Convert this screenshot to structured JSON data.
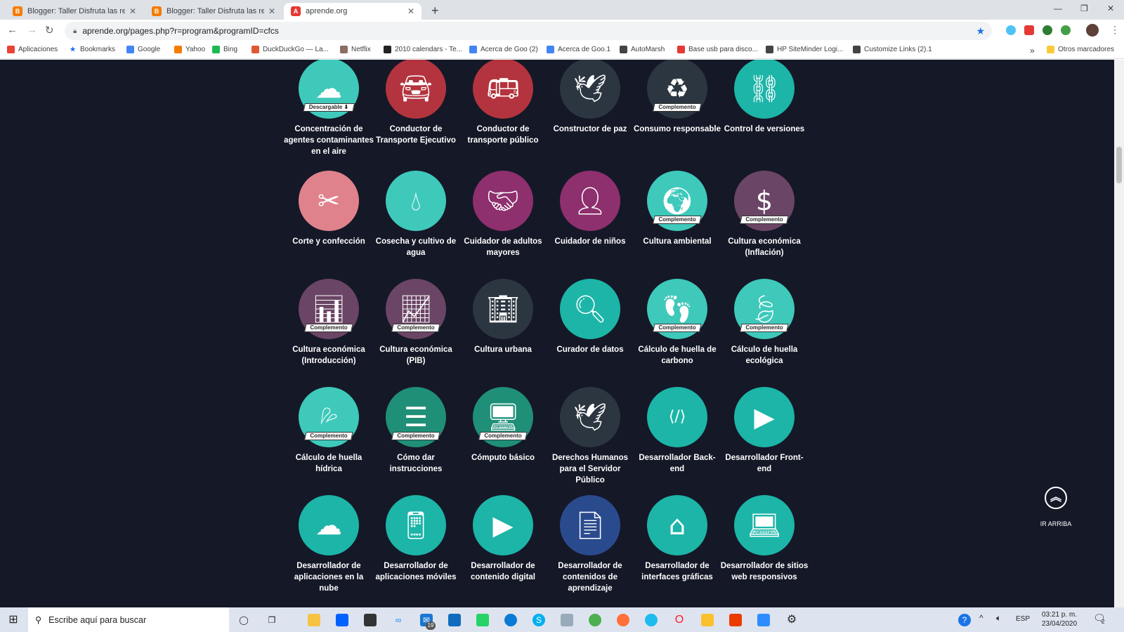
{
  "browser": {
    "tabs": [
      {
        "title": "Blogger: Taller Disfruta las redes",
        "icon": "blogger-icon",
        "color": "#f57c00"
      },
      {
        "title": "Blogger: Taller Disfruta las redes",
        "icon": "blogger-icon",
        "color": "#f57c00"
      },
      {
        "title": "aprende.org",
        "icon": "aprende-icon",
        "color": "#e53935"
      }
    ],
    "url": "aprende.org/pages.php?r=program&programID=cfcs",
    "bookmarks": [
      {
        "label": "Aplicaciones",
        "icon": "apps-grid-icon"
      },
      {
        "label": "Bookmarks",
        "icon": "star-icon"
      },
      {
        "label": "Google",
        "icon": "google-icon"
      },
      {
        "label": "Yahoo",
        "icon": "blogger-icon"
      },
      {
        "label": "Bing",
        "icon": "spotify-icon"
      },
      {
        "label": "DuckDuckGo — La...",
        "icon": "duckduckgo-icon"
      },
      {
        "label": "Netflix",
        "icon": "netflix-icon"
      },
      {
        "label": "2010 calendars - Te...",
        "icon": "wikipedia-icon"
      },
      {
        "label": "Acerca de Goo (2)",
        "icon": "google-icon"
      },
      {
        "label": "Acerca de Goo.1",
        "icon": "google-icon"
      },
      {
        "label": "AutoMarsh",
        "icon": "globe-icon"
      },
      {
        "label": "Base usb para disco...",
        "icon": "youtube-icon"
      },
      {
        "label": "HP SiteMinder Logi...",
        "icon": "globe-icon"
      },
      {
        "label": "Customize Links (2).1",
        "icon": "globe-icon"
      }
    ],
    "more_bookmarks": "»",
    "other_bookmarks": "Otros marcadores"
  },
  "programs": [
    {
      "label": "Concentración de agentes contaminantes en el aire",
      "color": "#3ec9bb",
      "icon": "cloud-building-icon",
      "badge": "Descargable ⬇"
    },
    {
      "label": "Conductor de Transporte Ejecutivo",
      "color": "#b3343e",
      "icon": "car-icon",
      "badge": ""
    },
    {
      "label": "Conductor de transporte público",
      "color": "#b3343e",
      "icon": "bus-icon",
      "badge": ""
    },
    {
      "label": "Constructor de paz",
      "color": "#2c3640",
      "icon": "dove-icon",
      "badge": ""
    },
    {
      "label": "Consumo responsable",
      "color": "#2c3640",
      "icon": "recycle-bag-icon",
      "badge": "Complemento"
    },
    {
      "label": "Control de versiones",
      "color": "#1cb5a8",
      "icon": "network-icon",
      "badge": ""
    },
    {
      "label": "Corte y confección",
      "color": "#e0828c",
      "icon": "thread-icon",
      "badge": ""
    },
    {
      "label": "Cosecha y cultivo de agua",
      "color": "#3ec9bb",
      "icon": "drops-icon",
      "badge": ""
    },
    {
      "label": "Cuidador de adultos mayores",
      "color": "#8e2f6e",
      "icon": "handshake-icon",
      "badge": ""
    },
    {
      "label": "Cuidador de niños",
      "color": "#8e2f6e",
      "icon": "caregiver-icon",
      "badge": ""
    },
    {
      "label": "Cultura ambiental",
      "color": "#3ec9bb",
      "icon": "globe-hands-icon",
      "badge": "Complemento"
    },
    {
      "label": "Cultura económica (Inflación)",
      "color": "#6b4565",
      "icon": "dollar-chart-icon",
      "badge": "Complemento"
    },
    {
      "label": "Cultura económica (Introducción)",
      "color": "#6b4565",
      "icon": "economy-icon",
      "badge": "Complemento"
    },
    {
      "label": "Cultura económica (PIB)",
      "color": "#6b4565",
      "icon": "pib-icon",
      "badge": "Complemento"
    },
    {
      "label": "Cultura urbana",
      "color": "#2c3640",
      "icon": "city-people-icon",
      "badge": ""
    },
    {
      "label": "Curador de datos",
      "color": "#1cb5a8",
      "icon": "monitor-search-icon",
      "badge": ""
    },
    {
      "label": "Cálculo de huella de carbono",
      "color": "#3ec9bb",
      "icon": "co2-footprint-icon",
      "badge": "Complemento"
    },
    {
      "label": "Cálculo de huella ecológica",
      "color": "#3ec9bb",
      "icon": "leaf-footprint-icon",
      "badge": "Complemento"
    },
    {
      "label": "Cálculo de huella hídrica",
      "color": "#3ec9bb",
      "icon": "water-footprint-icon",
      "badge": "Complemento"
    },
    {
      "label": "Cómo dar instrucciones",
      "color": "#1f8f78",
      "icon": "checklist-icon",
      "badge": "Complemento"
    },
    {
      "label": "Cómputo básico",
      "color": "#1f8f78",
      "icon": "computer-click-icon",
      "badge": "Complemento"
    },
    {
      "label": "Derechos Humanos para el Servidor Público",
      "color": "#2c3640",
      "icon": "dove-chain-icon",
      "badge": ""
    },
    {
      "label": "Desarrollador Back-end",
      "color": "#1cb5a8",
      "icon": "code-monitor-icon",
      "badge": ""
    },
    {
      "label": "Desarrollador Front-end",
      "color": "#1cb5a8",
      "icon": "web-monitor-icon",
      "badge": ""
    },
    {
      "label": "Desarrollador de aplicaciones en la nube",
      "color": "#1cb5a8",
      "icon": "cloud-terminal-icon",
      "badge": ""
    },
    {
      "label": "Desarrollador de aplicaciones móviles",
      "color": "#1cb5a8",
      "icon": "mobile-apps-icon",
      "badge": ""
    },
    {
      "label": "Desarrollador de contenido digital",
      "color": "#1cb5a8",
      "icon": "media-play-icon",
      "badge": ""
    },
    {
      "label": "Desarrollador de contenidos de aprendizaje",
      "color": "#2a4a8e",
      "icon": "document-media-icon",
      "badge": ""
    },
    {
      "label": "Desarrollador de interfaces gráficas",
      "color": "#1cb5a8",
      "icon": "home-tablet-icon",
      "badge": ""
    },
    {
      "label": "Desarrollador de sitios web responsivos",
      "color": "#1cb5a8",
      "icon": "responsive-devices-icon",
      "badge": ""
    }
  ],
  "scroll_top": {
    "label": "IR ARRIBA",
    "icon": "double-chevron-up-icon"
  },
  "taskbar": {
    "search_placeholder": "Escribe aquí para buscar",
    "mail_count": "19",
    "language": "ESP",
    "time": "03:21 p. m.",
    "date": "23/04/2020",
    "notification_count": "2"
  }
}
